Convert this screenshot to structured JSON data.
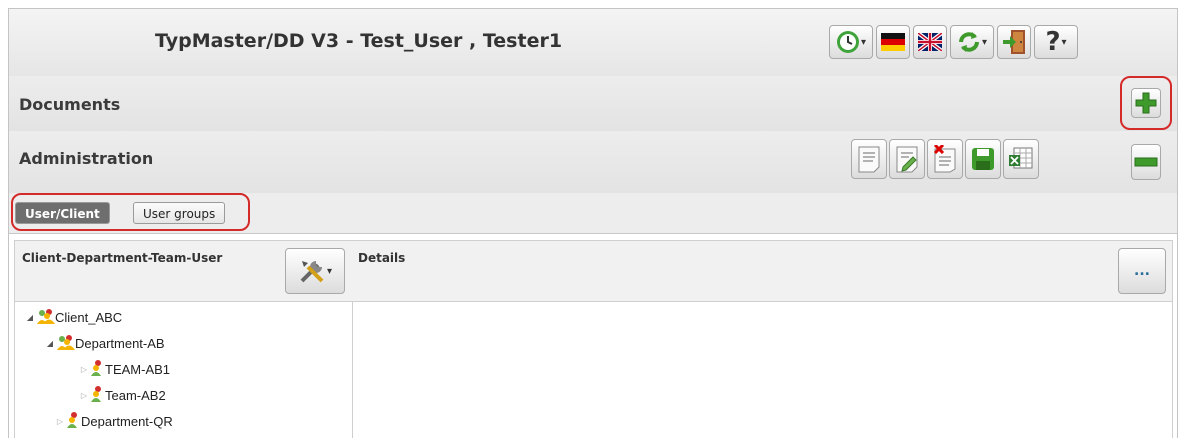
{
  "app": {
    "title": "TypMaster/DD V3 - Test_User , Tester1"
  },
  "sections": {
    "documents": "Documents",
    "administration": "Administration"
  },
  "tabs": [
    {
      "label": "User/Client",
      "active": true
    },
    {
      "label": "User groups",
      "active": false
    }
  ],
  "left_panel": {
    "header": "Client-Department-Team-User"
  },
  "right_panel": {
    "header": "Details",
    "more_button": "..."
  },
  "tree": [
    {
      "label": "Client_ABC",
      "level": 0,
      "state": "expanded"
    },
    {
      "label": "Department-AB",
      "level": 1,
      "state": "expanded"
    },
    {
      "label": "TEAM-AB1",
      "level": 2,
      "state": "collapsed"
    },
    {
      "label": "Team-AB2",
      "level": 2,
      "state": "collapsed"
    },
    {
      "label": "Department-QR",
      "level": 1,
      "state": "collapsed"
    }
  ],
  "toolbar_icons": [
    "clock-icon",
    "german-flag-icon",
    "uk-flag-icon",
    "refresh-icon",
    "exit-door-icon",
    "help-icon"
  ],
  "admin_icons": [
    "document-icon",
    "edit-document-icon",
    "delete-document-icon",
    "save-icon",
    "excel-export-icon"
  ],
  "colors": {
    "highlight": "#d42a2a",
    "active_tab": "#6e6e6e",
    "add_green": "#3e9a2b"
  }
}
